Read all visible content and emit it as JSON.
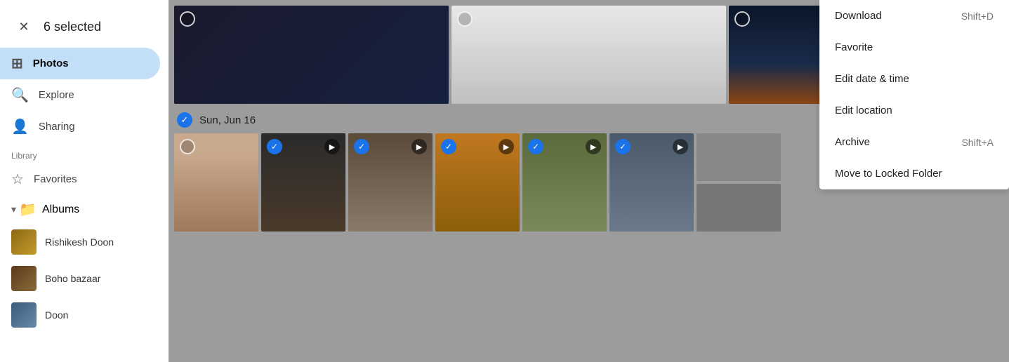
{
  "header": {
    "selected_count": "6 selected"
  },
  "sidebar": {
    "nav": [
      {
        "id": "photos",
        "label": "Photos",
        "icon": "🖼",
        "active": true
      },
      {
        "id": "explore",
        "label": "Explore",
        "icon": "🔍",
        "active": false
      },
      {
        "id": "sharing",
        "label": "Sharing",
        "icon": "👤",
        "active": false
      }
    ],
    "library_label": "Library",
    "library_items": [
      {
        "id": "favorites",
        "label": "Favorites",
        "icon": "☆"
      },
      {
        "id": "albums",
        "label": "Albums",
        "icon": "📁",
        "has_expand": true
      }
    ],
    "albums": [
      {
        "id": "rishikesh",
        "label": "Rishikesh Doon"
      },
      {
        "id": "boho",
        "label": "Boho bazaar"
      },
      {
        "id": "doon",
        "label": "Doon"
      }
    ]
  },
  "photos": {
    "date_row": {
      "label": "Sun, Jun 16"
    }
  },
  "dropdown": {
    "items": [
      {
        "id": "download",
        "label": "Download",
        "shortcut": "Shift+D"
      },
      {
        "id": "favorite",
        "label": "Favorite",
        "shortcut": ""
      },
      {
        "id": "edit-date-time",
        "label": "Edit date & time",
        "shortcut": ""
      },
      {
        "id": "edit-location",
        "label": "Edit location",
        "shortcut": ""
      },
      {
        "id": "archive",
        "label": "Archive",
        "shortcut": "Shift+A"
      },
      {
        "id": "move-locked",
        "label": "Move to Locked Folder",
        "shortcut": ""
      }
    ]
  }
}
